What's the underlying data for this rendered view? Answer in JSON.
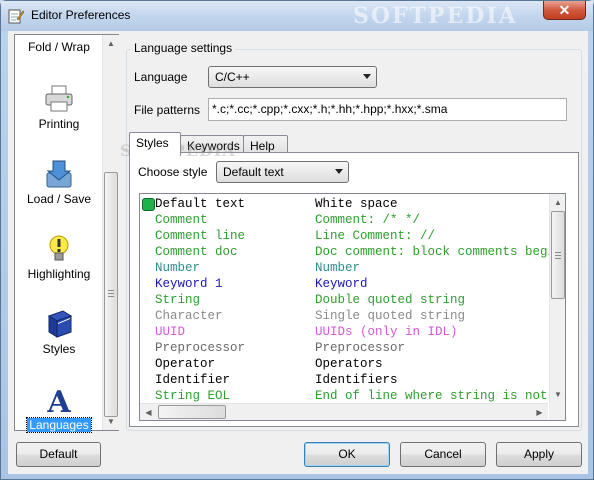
{
  "window": {
    "title": "Editor Preferences",
    "watermark": "SOFTPEDIA",
    "close_glyph": "✕"
  },
  "categories": [
    {
      "label": "Fold / Wrap",
      "icon": "fold-wrap-icon"
    },
    {
      "label": "Printing",
      "icon": "printer-icon"
    },
    {
      "label": "Load / Save",
      "icon": "load-save-icon"
    },
    {
      "label": "Highlighting",
      "icon": "bulb-icon"
    },
    {
      "label": "Styles",
      "icon": "book-icon"
    },
    {
      "label": "Languages",
      "icon": "letter-a-icon",
      "selected": true
    }
  ],
  "language_settings": {
    "group_title": "Language settings",
    "language_label": "Language",
    "language_value": "C/C++",
    "patterns_label": "File patterns",
    "patterns_value": "*.c;*.cc;*.cpp;*.cxx;*.h;*.hh;*.hpp;*.hxx;*.sma"
  },
  "tabs": [
    "Styles",
    "Keywords",
    "Help"
  ],
  "tab_watermark": "SOFTPEDIA",
  "styles_tab": {
    "choose_label": "Choose style",
    "choose_value": "Default text",
    "rows": [
      {
        "name": "Default text",
        "desc": "White space",
        "color": "#000000"
      },
      {
        "name": "Comment",
        "desc": "Comment: /* */",
        "color": "#2e9e2e"
      },
      {
        "name": "Comment line",
        "desc": "Line Comment: //",
        "color": "#2e9e2e"
      },
      {
        "name": "Comment doc",
        "desc": "Doc comment: block comments beginning with /** or /*!",
        "color": "#2e9e2e"
      },
      {
        "name": "Number",
        "desc": "Number",
        "color": "#2c8c8c"
      },
      {
        "name": "Keyword 1",
        "desc": "Keyword",
        "color": "#1a1ab4"
      },
      {
        "name": "String",
        "desc": "Double quoted string",
        "color": "#2e9e2e"
      },
      {
        "name": "Character",
        "desc": "Single quoted string",
        "color": "#8a8a8a"
      },
      {
        "name": "UUID",
        "desc": "UUIDs (only in IDL)",
        "color": "#d25ad2"
      },
      {
        "name": "Preprocessor",
        "desc": "Preprocessor",
        "color": "#6a6a6a"
      },
      {
        "name": "Operator",
        "desc": "Operators",
        "color": "#000000"
      },
      {
        "name": "Identifier",
        "desc": "Identifiers",
        "color": "#000000"
      },
      {
        "name": "String EOL",
        "desc": "End of line where string is not closed",
        "color": "#2e9e2e"
      }
    ]
  },
  "buttons": {
    "default": "Default",
    "ok": "OK",
    "cancel": "Cancel",
    "apply": "Apply"
  }
}
